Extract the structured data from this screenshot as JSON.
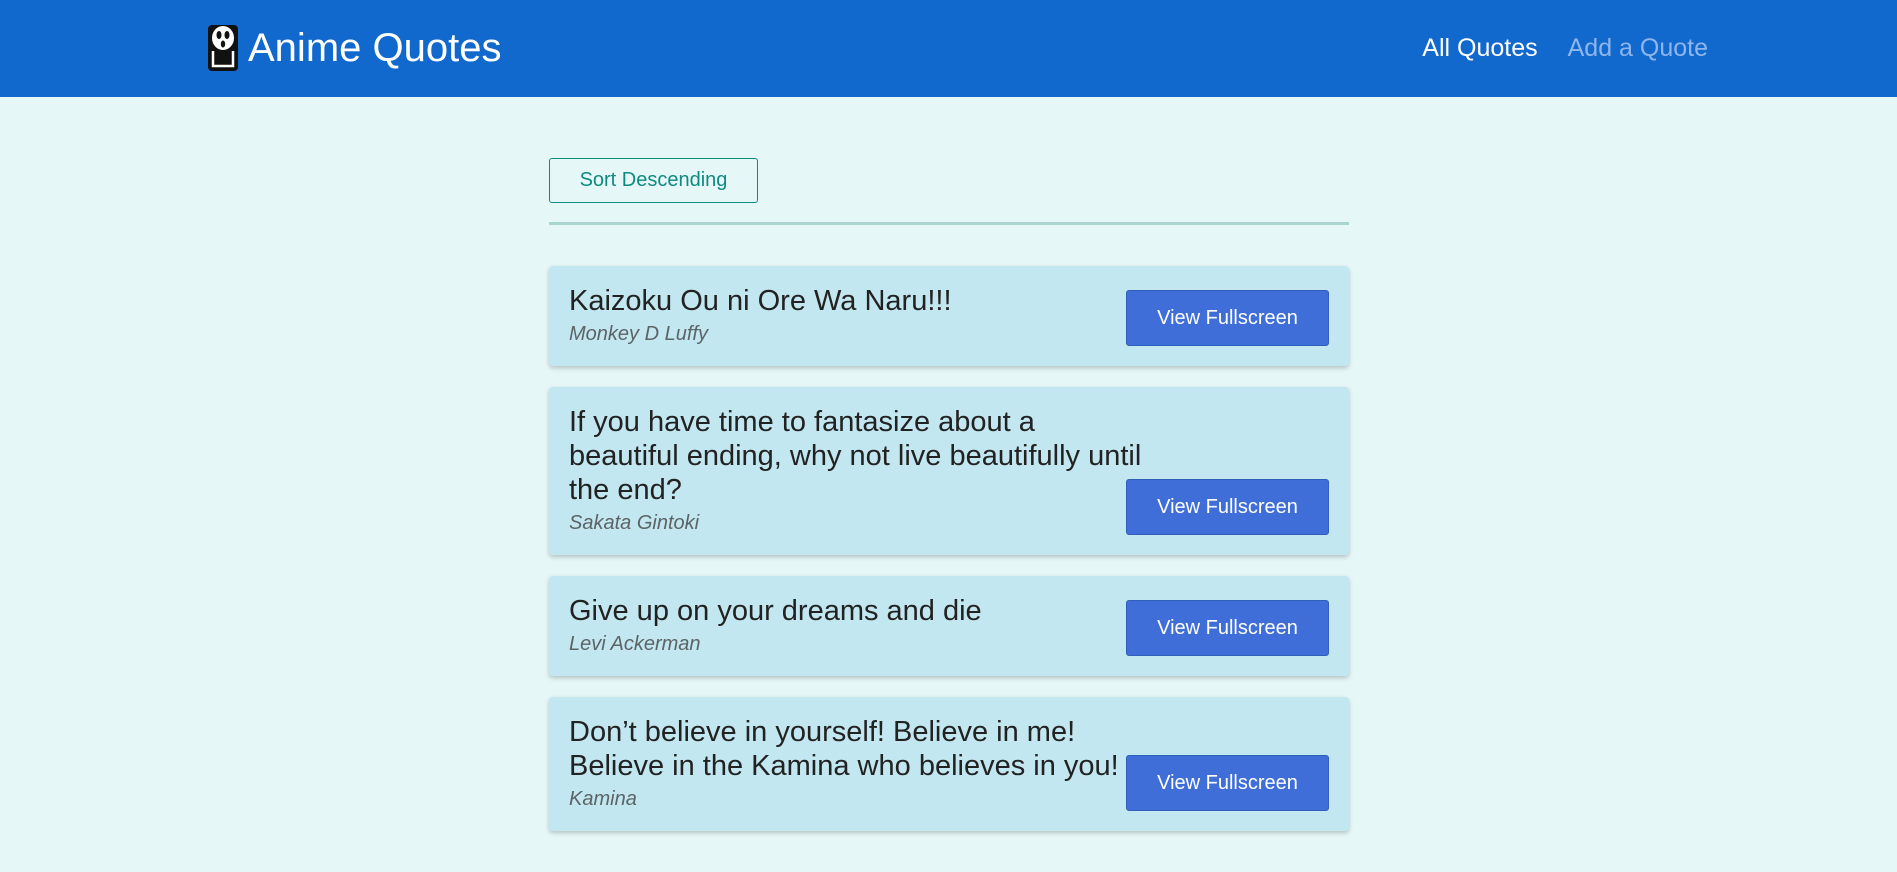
{
  "header": {
    "logo_icon": "ghost-mask-icon",
    "title": "Anime Quotes",
    "nav": [
      {
        "label": "All Quotes",
        "active": true
      },
      {
        "label": "Add a Quote",
        "active": false
      }
    ]
  },
  "toolbar": {
    "sort_label": "Sort Descending"
  },
  "quotes": [
    {
      "text": "Kaizoku Ou ni Ore Wa Naru!!!",
      "author": "Monkey D Luffy",
      "button": "View Fullscreen"
    },
    {
      "text": "If you have time to fantasize about a beautiful ending, why not live beautifully until the end?",
      "author": "Sakata Gintoki",
      "button": "View Fullscreen"
    },
    {
      "text": "Give up on your dreams and die",
      "author": "Levi Ackerman",
      "button": "View Fullscreen"
    },
    {
      "text": "Don’t believe in yourself! Believe in me! Believe in the Kamina who believes in you!",
      "author": "Kamina",
      "button": "View Fullscreen"
    }
  ],
  "colors": {
    "header_bg": "#1168cd",
    "page_bg": "#e6f7f7",
    "card_bg": "#c2e7f0",
    "button_bg": "#3f6ed8",
    "accent": "#0f8a80"
  }
}
